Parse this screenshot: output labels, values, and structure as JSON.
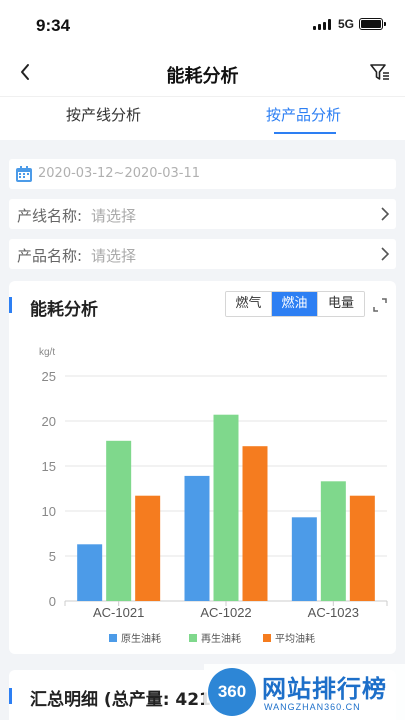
{
  "status_bar": {
    "time": "9:34",
    "network": "5G"
  },
  "nav": {
    "title": "能耗分析"
  },
  "tabs": [
    {
      "label": "按产线分析"
    },
    {
      "label": "按产品分析"
    }
  ],
  "filters": {
    "date_range": "2020-03-12~2020-03-11",
    "line": {
      "label": "产线名称:",
      "placeholder": "请选择"
    },
    "product": {
      "label": "产品名称:",
      "placeholder": "请选择"
    }
  },
  "card": {
    "title": "能耗分析",
    "segments": [
      {
        "label": "燃气"
      },
      {
        "label": "燃油",
        "active": true
      },
      {
        "label": "电量"
      }
    ]
  },
  "chart_data": {
    "type": "bar",
    "ylabel": "kg/t",
    "ylim": [
      0,
      25
    ],
    "yticks": [
      0,
      5,
      10,
      15,
      20,
      25
    ],
    "categories": [
      "AC-1021",
      "AC-1022",
      "AC-1023"
    ],
    "series": [
      {
        "name": "原生油耗",
        "color": "#4c9be8",
        "values": [
          6.3,
          13.9,
          9.3
        ]
      },
      {
        "name": "再生油耗",
        "color": "#7fd88c",
        "values": [
          17.8,
          20.7,
          13.3
        ]
      },
      {
        "name": "平均油耗",
        "color": "#f57c1f",
        "values": [
          11.7,
          17.2,
          11.7
        ]
      }
    ],
    "grid": true,
    "legend": "bottom"
  },
  "summary": {
    "title": "汇总明细 (总产量: 421"
  },
  "watermark": {
    "badge": "360",
    "text": "网站排行榜",
    "sub": "WANGZHAN360.CN"
  }
}
